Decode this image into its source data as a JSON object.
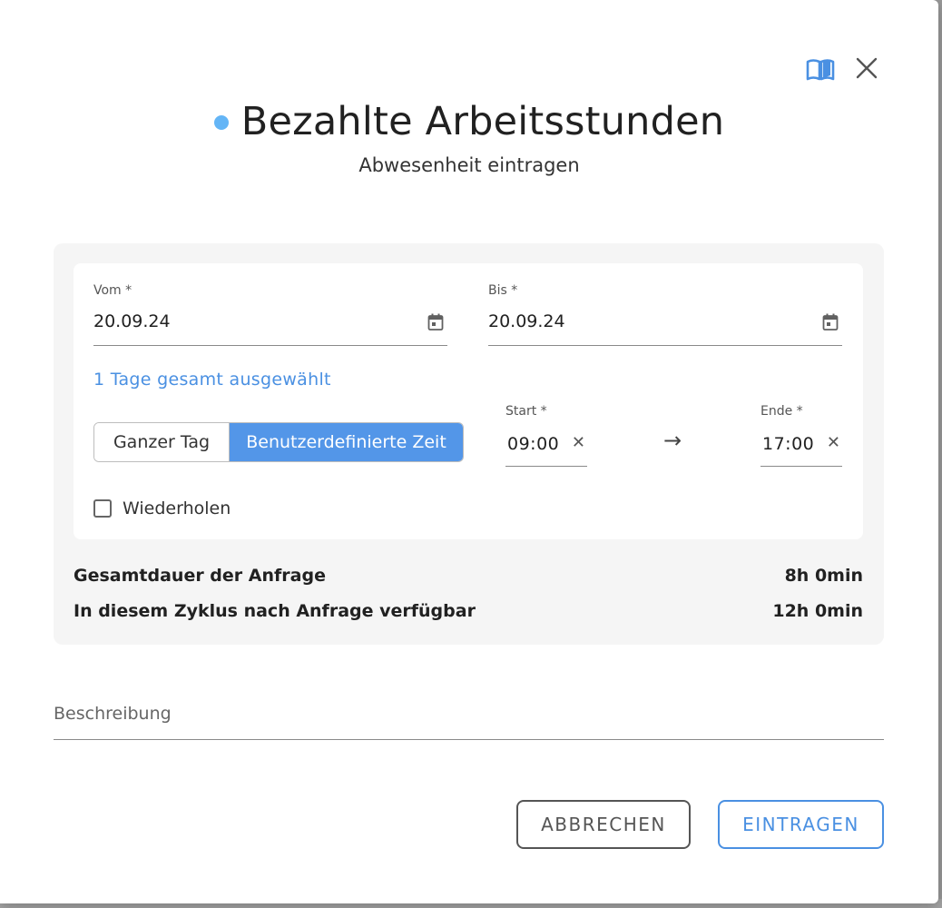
{
  "dialog": {
    "title": "Bezahlte Arbeitsstunden",
    "subtitle": "Abwesenheit eintragen",
    "accent_dot_color": "#64b5f6",
    "icons": {
      "help": "book-open-icon",
      "close": "close-icon"
    }
  },
  "form": {
    "from": {
      "label": "Vom *",
      "value": "20.09.24"
    },
    "to": {
      "label": "Bis *",
      "value": "20.09.24"
    },
    "days_selected": "1 Tage gesamt ausgewählt",
    "mode_toggle": {
      "options": [
        "Ganzer Tag",
        "Benutzerdefinierte Zeit"
      ],
      "selected": "Benutzerdefinierte Zeit"
    },
    "start": {
      "label": "Start *",
      "value": "09:00"
    },
    "end": {
      "label": "Ende *",
      "value": "17:00"
    },
    "time_separator": "→",
    "repeat": {
      "label": "Wiederholen",
      "checked": false
    }
  },
  "summary": {
    "total_label": "Gesamtdauer der Anfrage",
    "total_value": "8h 0min",
    "available_label": "In diesem Zyklus nach Anfrage verfügbar",
    "available_value": "12h 0min"
  },
  "description": {
    "label": "Beschreibung",
    "value": ""
  },
  "actions": {
    "cancel": "ABBRECHEN",
    "submit": "EINTRAGEN"
  },
  "colors": {
    "primary": "#4a90e2",
    "toggle_selected": "#5396e8"
  }
}
